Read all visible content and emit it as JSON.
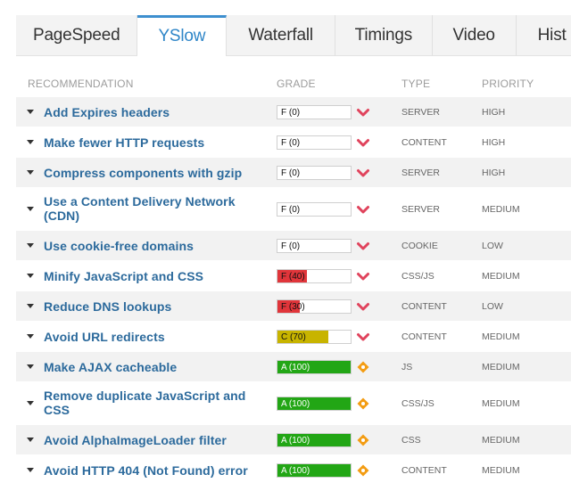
{
  "tabs": [
    {
      "label": "PageSpeed",
      "active": false
    },
    {
      "label": "YSlow",
      "active": true
    },
    {
      "label": "Waterfall",
      "active": false
    },
    {
      "label": "Timings",
      "active": false
    },
    {
      "label": "Video",
      "active": false
    },
    {
      "label": "Hist",
      "active": false
    }
  ],
  "table": {
    "headers": {
      "recommendation": "RECOMMENDATION",
      "grade": "GRADE",
      "type": "TYPE",
      "priority": "PRIORITY"
    },
    "rows": [
      {
        "label": "Add Expires headers",
        "grade_label": "F (0)",
        "grade_pct": 0,
        "grade_color": "#ffffff",
        "icon": "chevron-down-icon",
        "type": "SERVER",
        "priority": "HIGH",
        "lines": 1
      },
      {
        "label": "Make fewer HTTP requests",
        "grade_label": "F (0)",
        "grade_pct": 0,
        "grade_color": "#ffffff",
        "icon": "chevron-down-icon",
        "type": "CONTENT",
        "priority": "HIGH",
        "lines": 1
      },
      {
        "label": "Compress components with gzip",
        "grade_label": "F (0)",
        "grade_pct": 0,
        "grade_color": "#ffffff",
        "icon": "chevron-down-icon",
        "type": "SERVER",
        "priority": "HIGH",
        "lines": 1
      },
      {
        "label": "Use a Content Delivery Network (CDN)",
        "grade_label": "F (0)",
        "grade_pct": 0,
        "grade_color": "#ffffff",
        "icon": "chevron-down-icon",
        "type": "SERVER",
        "priority": "MEDIUM",
        "lines": 2
      },
      {
        "label": "Use cookie-free domains",
        "grade_label": "F (0)",
        "grade_pct": 0,
        "grade_color": "#ffffff",
        "icon": "chevron-down-icon",
        "type": "COOKIE",
        "priority": "LOW",
        "lines": 1
      },
      {
        "label": "Minify JavaScript and CSS",
        "grade_label": "F (40)",
        "grade_pct": 40,
        "grade_color": "#e0353a",
        "icon": "chevron-down-icon",
        "type": "CSS/JS",
        "priority": "MEDIUM",
        "lines": 1
      },
      {
        "label": "Reduce DNS lookups",
        "grade_label": "F (30)",
        "grade_pct": 30,
        "grade_color": "#e0353a",
        "icon": "chevron-down-icon",
        "type": "CONTENT",
        "priority": "LOW",
        "lines": 1
      },
      {
        "label": "Avoid URL redirects",
        "grade_label": "C (70)",
        "grade_pct": 70,
        "grade_color": "#c8b400",
        "icon": "chevron-down-icon",
        "type": "CONTENT",
        "priority": "MEDIUM",
        "lines": 1
      },
      {
        "label": "Make AJAX cacheable",
        "grade_label": "A (100)",
        "grade_pct": 100,
        "grade_color": "#22a615",
        "icon": "diamond-icon",
        "type": "JS",
        "priority": "MEDIUM",
        "lines": 1
      },
      {
        "label": "Remove duplicate JavaScript and CSS",
        "grade_label": "A (100)",
        "grade_pct": 100,
        "grade_color": "#22a615",
        "icon": "diamond-icon",
        "type": "CSS/JS",
        "priority": "MEDIUM",
        "lines": 2
      },
      {
        "label": "Avoid AlphaImageLoader filter",
        "grade_label": "A (100)",
        "grade_pct": 100,
        "grade_color": "#22a615",
        "icon": "diamond-icon",
        "type": "CSS",
        "priority": "MEDIUM",
        "lines": 1
      },
      {
        "label": "Avoid HTTP 404 (Not Found) error",
        "grade_label": "A (100)",
        "grade_pct": 100,
        "grade_color": "#22a615",
        "icon": "diamond-icon",
        "type": "CONTENT",
        "priority": "MEDIUM",
        "lines": 1
      }
    ]
  },
  "colors": {
    "accent": "#2f86c8",
    "link": "#2c6a9c",
    "chevron": "#e0435c",
    "diamond": "#f39c12"
  }
}
